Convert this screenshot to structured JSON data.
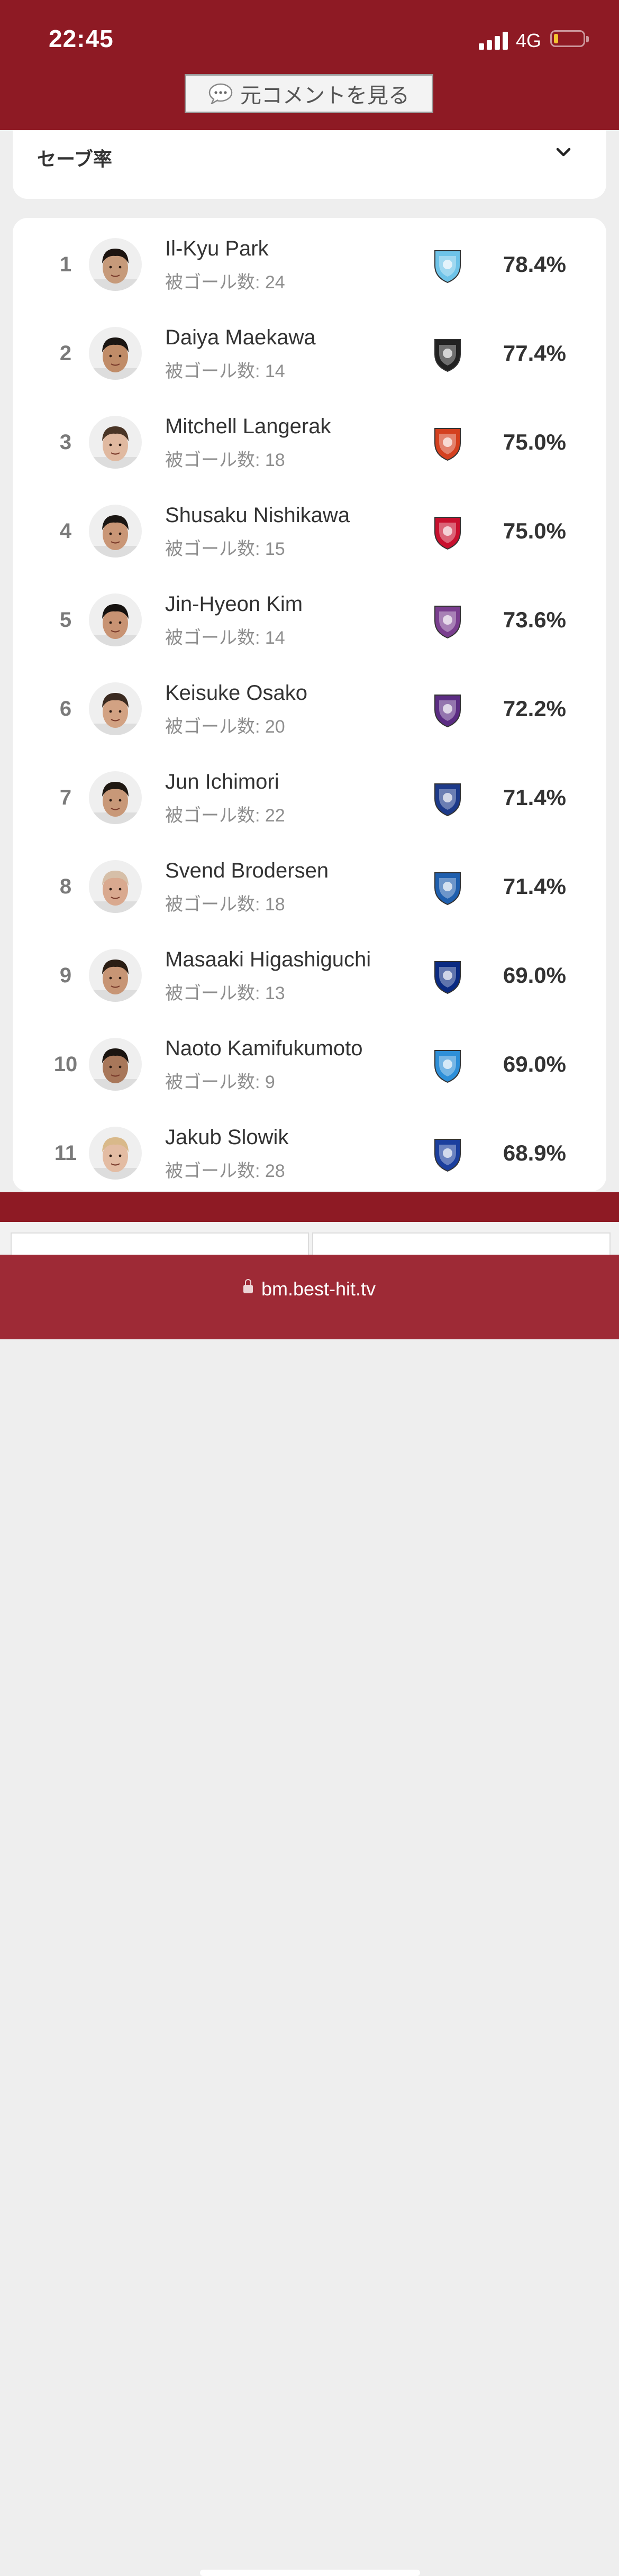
{
  "status": {
    "time": "22:45",
    "network": "4G"
  },
  "comment_button": {
    "label": "元コメントを見る"
  },
  "selector": {
    "label": "セーブ率"
  },
  "rows": [
    {
      "rank": "1",
      "name": "Il-Kyu Park",
      "goals": "被ゴール数: 24",
      "rate": "78.4%",
      "crest_color": "#6ec3e8"
    },
    {
      "rank": "2",
      "name": "Daiya Maekawa",
      "goals": "被ゴール数: 14",
      "rate": "77.4%",
      "crest_color": "#222222"
    },
    {
      "rank": "3",
      "name": "Mitchell Langerak",
      "goals": "被ゴール数: 18",
      "rate": "75.0%",
      "crest_color": "#d4401f"
    },
    {
      "rank": "4",
      "name": "Shusaku Nishikawa",
      "goals": "被ゴール数: 15",
      "rate": "75.0%",
      "crest_color": "#c8102e"
    },
    {
      "rank": "5",
      "name": "Jin-Hyeon Kim",
      "goals": "被ゴール数: 14",
      "rate": "73.6%",
      "crest_color": "#7a3e8f"
    },
    {
      "rank": "6",
      "name": "Keisuke Osako",
      "goals": "被ゴール数: 20",
      "rate": "72.2%",
      "crest_color": "#5b2c83"
    },
    {
      "rank": "7",
      "name": "Jun Ichimori",
      "goals": "被ゴール数: 22",
      "rate": "71.4%",
      "crest_color": "#1d3a8a"
    },
    {
      "rank": "8",
      "name": "Svend Brodersen",
      "goals": "被ゴール数: 18",
      "rate": "71.4%",
      "crest_color": "#1f5fae"
    },
    {
      "rank": "9",
      "name": "Masaaki Higashiguchi",
      "goals": "被ゴール数: 13",
      "rate": "69.0%",
      "crest_color": "#0a2a82"
    },
    {
      "rank": "10",
      "name": "Naoto Kamifukumoto",
      "goals": "被ゴール数: 9",
      "rate": "69.0%",
      "crest_color": "#2e8fd8"
    },
    {
      "rank": "11",
      "name": "Jakub Slowik",
      "goals": "被ゴール数: 28",
      "rate": "68.9%",
      "crest_color": "#1b3f9e"
    }
  ],
  "url": "bm.best-hit.tv",
  "colors": {
    "brand_red": "#8e1a24",
    "url_bar": "#9e2a36"
  }
}
